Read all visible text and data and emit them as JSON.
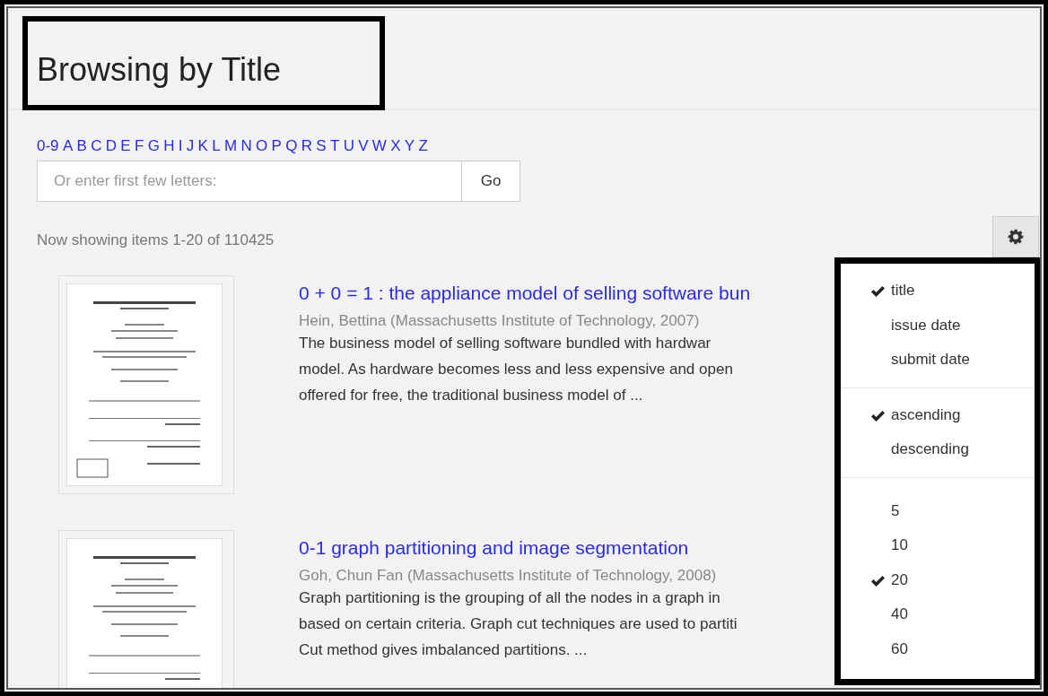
{
  "page_title": "Browsing by Title",
  "letter_links": [
    "0-9",
    "A",
    "B",
    "C",
    "D",
    "E",
    "F",
    "G",
    "H",
    "I",
    "J",
    "K",
    "L",
    "M",
    "N",
    "O",
    "P",
    "Q",
    "R",
    "S",
    "T",
    "U",
    "V",
    "W",
    "X",
    "Y",
    "Z"
  ],
  "jump_field": {
    "placeholder": "Or enter first few letters:"
  },
  "go_button": "Go",
  "results_summary": "Now showing items 1-20 of 110425",
  "items": [
    {
      "title": "0 + 0 = 1 : the appliance model of selling software bun",
      "byline": "Hein, Bettina (Massachusetts Institute of Technology, 2007)",
      "abstract_lines": [
        "The business model of selling software bundled with hardwar",
        "model. As hardware becomes less and less expensive and open",
        "offered for free, the traditional business model of ..."
      ]
    },
    {
      "title": "0-1 graph partitioning and image segmentation",
      "byline": "Goh, Chun Fan (Massachusetts Institute of Technology, 2008)",
      "abstract_lines": [
        "Graph partitioning is the grouping of all the nodes in a graph in",
        "based on certain criteria. Graph cut techniques are used to partiti",
        "Cut method gives imbalanced partitions. ..."
      ]
    }
  ],
  "sort_menu": {
    "sections": [
      {
        "options": [
          {
            "label": "title",
            "selected": true
          },
          {
            "label": "issue date",
            "selected": false
          },
          {
            "label": "submit date",
            "selected": false
          }
        ]
      },
      {
        "options": [
          {
            "label": "ascending",
            "selected": true
          },
          {
            "label": "descending",
            "selected": false
          }
        ]
      },
      {
        "options": [
          {
            "label": "5",
            "selected": false
          },
          {
            "label": "10",
            "selected": false
          },
          {
            "label": "20",
            "selected": true
          },
          {
            "label": "40",
            "selected": false
          },
          {
            "label": "60",
            "selected": false
          }
        ]
      }
    ]
  }
}
